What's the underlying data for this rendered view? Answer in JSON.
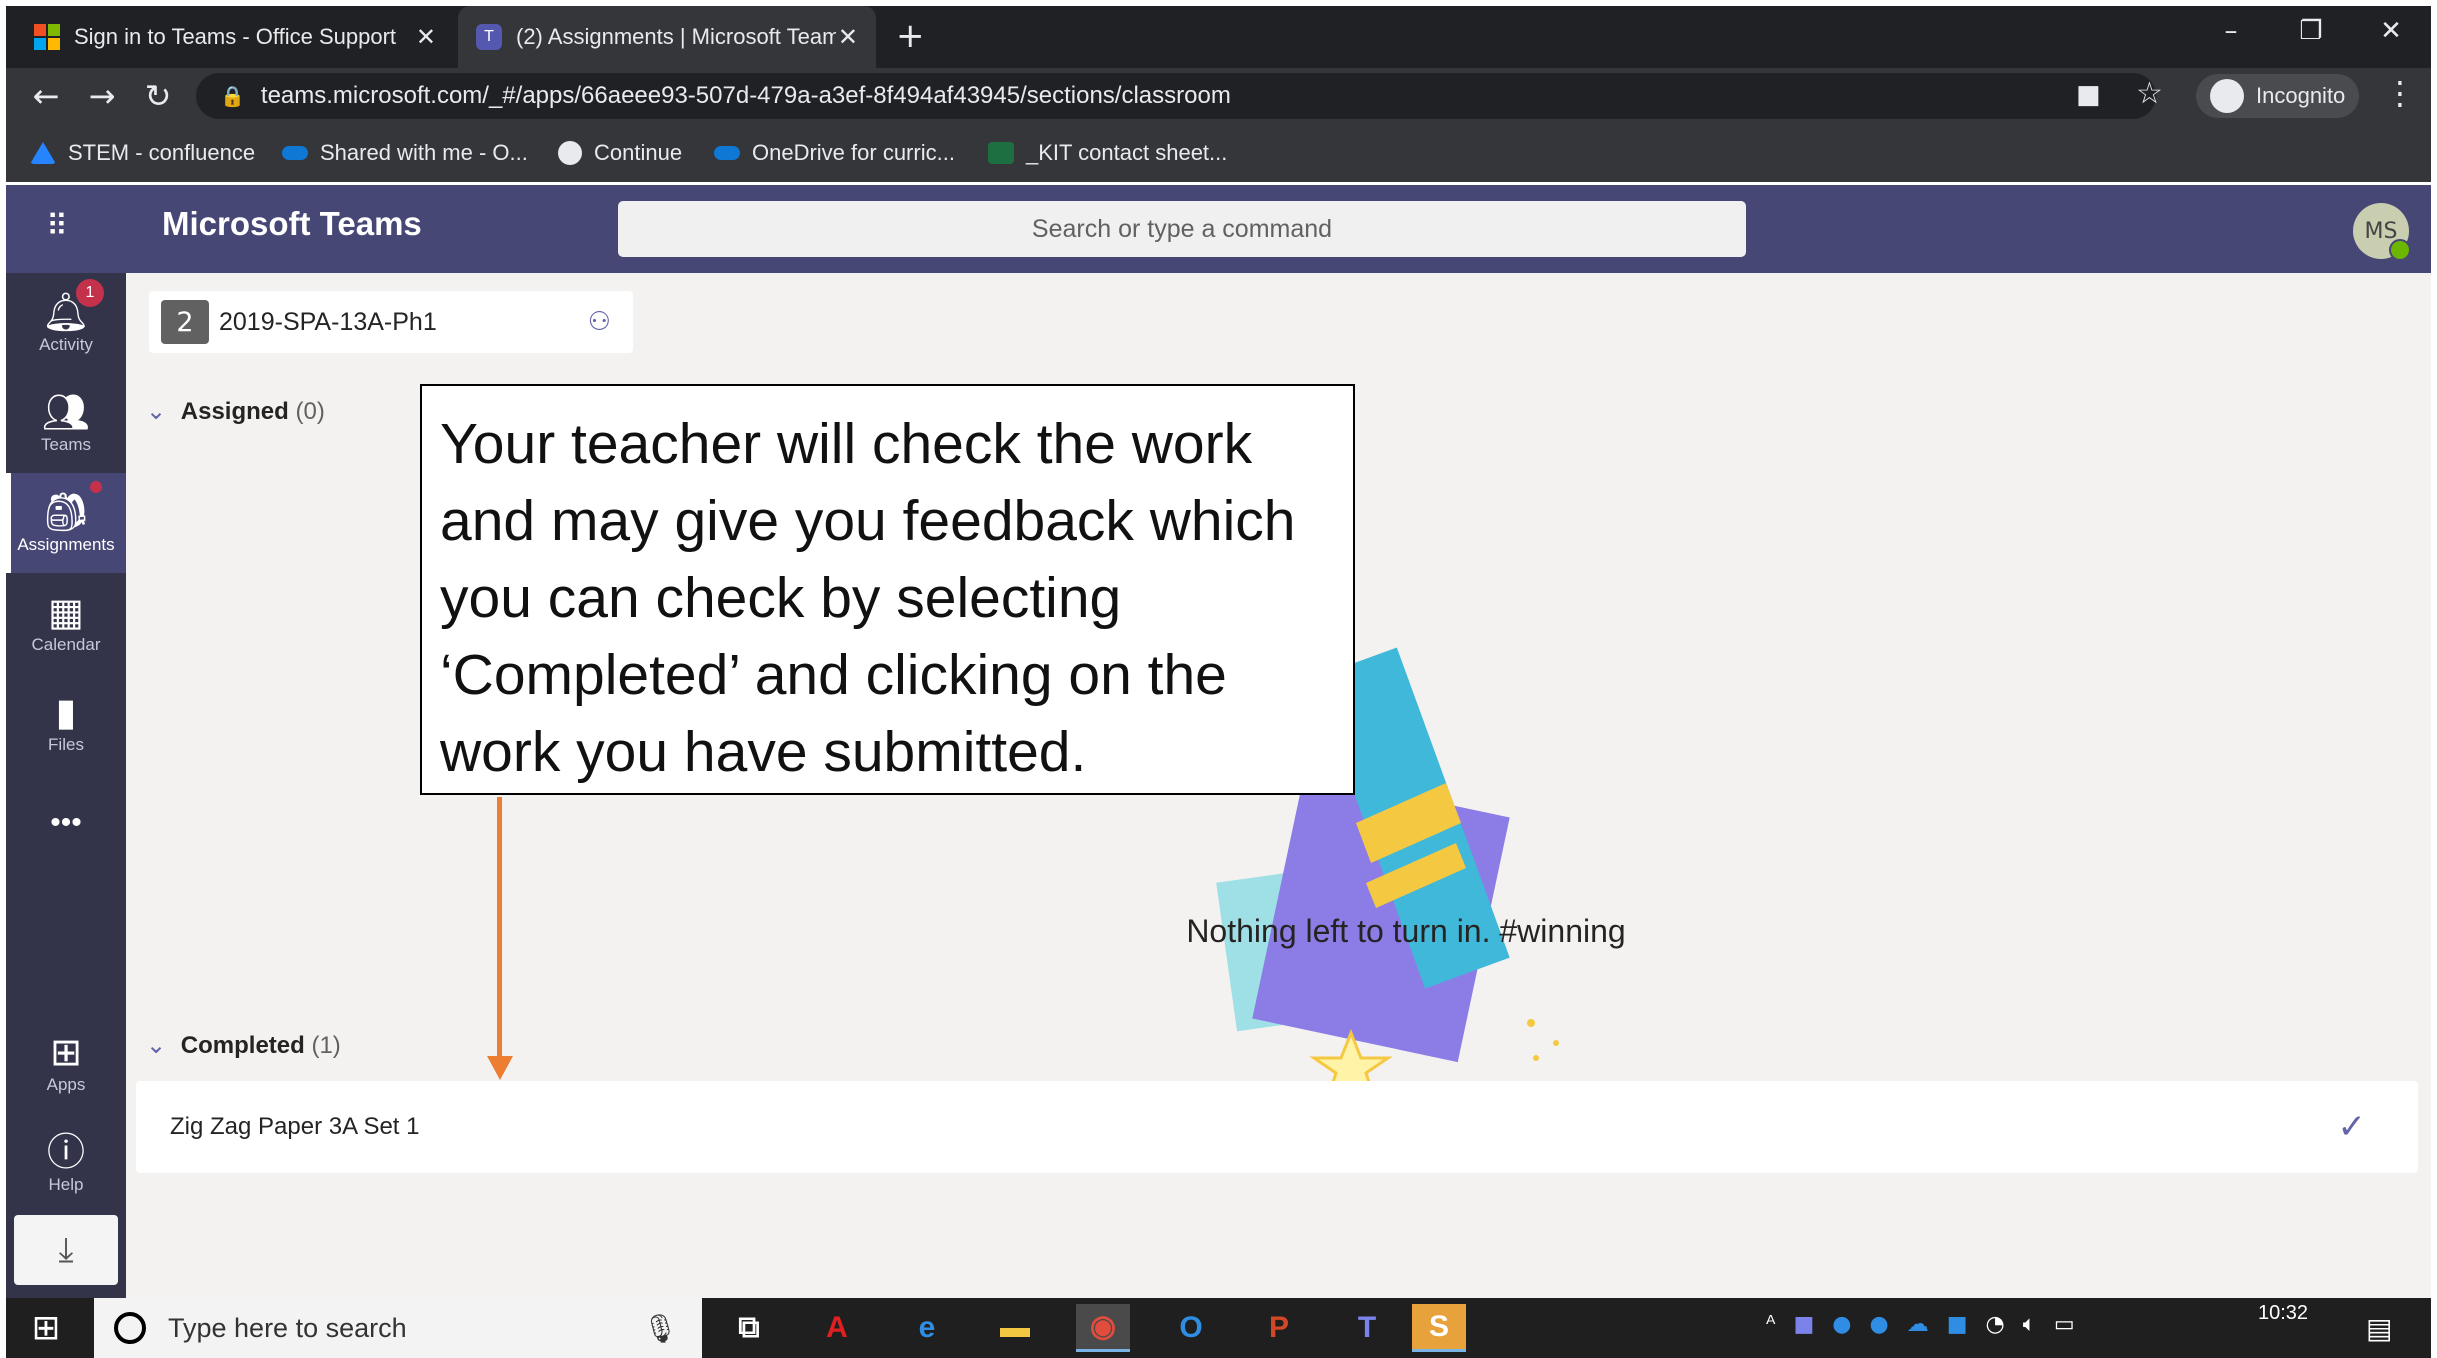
{
  "browser": {
    "tabs": [
      {
        "title": "Sign in to Teams - Office Support",
        "favicon": "microsoft-logo-icon",
        "active": false
      },
      {
        "title": "(2) Assignments | Microsoft Team",
        "favicon": "teams-icon",
        "active": true
      }
    ],
    "new_tab": "+",
    "window_controls": {
      "minimize": "–",
      "restore": "❐",
      "close": "✕"
    },
    "url": "teams.microsoft.com/_#/apps/66aeee93-507d-479a-a3ef-8f494af43945/sections/classroom",
    "profile_label": "Incognito",
    "bookmarks": [
      {
        "label": "STEM - confluence",
        "icon": "confluence-icon",
        "color": "#2684ff"
      },
      {
        "label": "Shared with me - O...",
        "icon": "onedrive-icon",
        "color": "#0f78d4"
      },
      {
        "label": "Continue",
        "icon": "globe-icon",
        "color": "#e8eaed"
      },
      {
        "label": "OneDrive for curric...",
        "icon": "onedrive-icon",
        "color": "#0f78d4"
      },
      {
        "label": "_KIT contact sheet...",
        "icon": "excel-icon",
        "color": "#1d6f42"
      }
    ]
  },
  "teams": {
    "app_title": "Microsoft Teams",
    "search_placeholder": "Search or type a command",
    "avatar_initials": "MS",
    "accent": "#464775",
    "rail": [
      {
        "label": "Activity",
        "icon": "bell-icon",
        "badge": "1"
      },
      {
        "label": "Teams",
        "icon": "teams-people-icon"
      },
      {
        "label": "Assignments",
        "icon": "assignments-bag-icon",
        "active": true,
        "dot": true
      },
      {
        "label": "Calendar",
        "icon": "calendar-icon"
      },
      {
        "label": "Files",
        "icon": "file-icon"
      },
      {
        "label": "•••",
        "icon": "more-icon"
      },
      {
        "label": "Apps",
        "icon": "apps-icon"
      },
      {
        "label": "Help",
        "icon": "help-icon"
      }
    ],
    "class": {
      "number": "2",
      "name": "2019-SPA-13A-Ph1"
    },
    "assigned": {
      "label": "Assigned",
      "count": "(0)"
    },
    "empty_message": "Nothing left to turn in. #winning",
    "completed": {
      "label": "Completed",
      "count": "(1)"
    },
    "completed_items": [
      {
        "title": "Zig Zag Paper 3A Set 1",
        "status_icon": "checkmark-icon"
      }
    ]
  },
  "annotation": {
    "lines": [
      "Your teacher will check the work",
      "and may give you feedback which",
      "you can check by selecting",
      "‘Completed’ and clicking on the",
      "work you have submitted."
    ],
    "arrow_color": "#ed7d31"
  },
  "taskbar": {
    "search_placeholder": "Type here to search",
    "clock": "10:32",
    "apps": [
      "task-view-icon",
      "acrobat-icon",
      "edge-icon",
      "file-explorer-icon",
      "chrome-icon",
      "outlook-icon",
      "powerpoint-icon",
      "teams-icon",
      "skype-icon"
    ]
  }
}
